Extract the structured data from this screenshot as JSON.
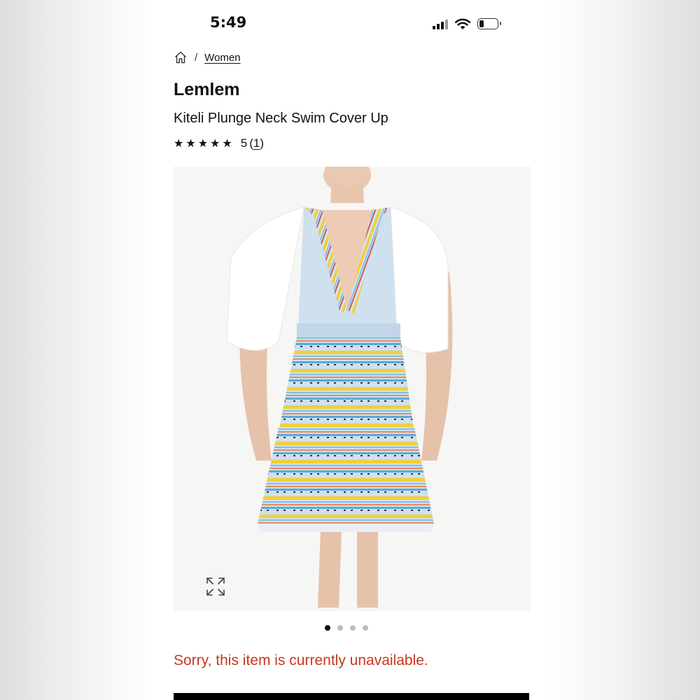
{
  "status_bar": {
    "time": "5:49",
    "signal_icon": "cellular-signal-icon",
    "wifi_icon": "wifi-icon",
    "battery_icon": "battery-icon",
    "battery_level": 0.2
  },
  "breadcrumb": {
    "home_icon": "home-icon",
    "separator": "/",
    "current": "Women"
  },
  "product": {
    "brand": "Lemlem",
    "name": "Kiteli Plunge Neck Swim Cover Up",
    "rating": {
      "stars": "★★★★★",
      "stars_filled": 5,
      "value": "5",
      "count_open": "(",
      "count": "1",
      "count_close": ")"
    },
    "image": {
      "expand_icon": "expand-icon",
      "carousel_total": 4,
      "carousel_active": 1
    },
    "availability_message": "Sorry, this item is currently unavailable."
  },
  "colors": {
    "text": "#111111",
    "error": "#c4391d",
    "dress_base": "#cfe0ef",
    "stripe_yellow": "#f2cf3a",
    "stripe_blue": "#7fc2e3",
    "stripe_orange": "#e98a5c"
  }
}
